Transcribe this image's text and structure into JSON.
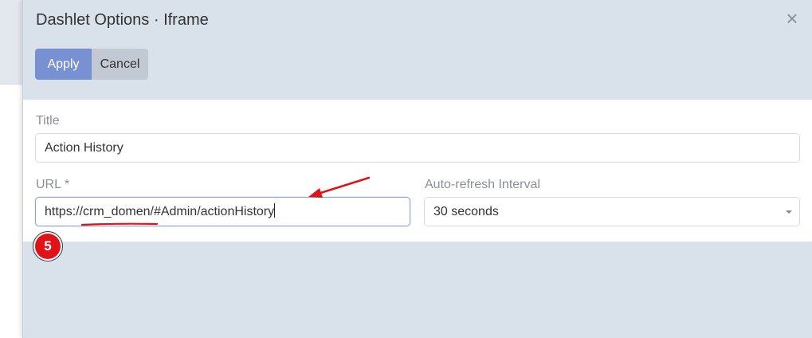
{
  "modal": {
    "title": "Dashlet Options · Iframe",
    "close_icon": "close-icon"
  },
  "buttons": {
    "apply": "Apply",
    "cancel": "Cancel"
  },
  "form": {
    "title_label": "Title",
    "title_value": "Action History",
    "url_label": "URL *",
    "url_value": "https://crm_domen/#Admin/actionHistory",
    "refresh_label": "Auto-refresh Interval",
    "refresh_value": "30 seconds"
  },
  "annotation": {
    "step_number": "5",
    "color": "#e0131a"
  }
}
